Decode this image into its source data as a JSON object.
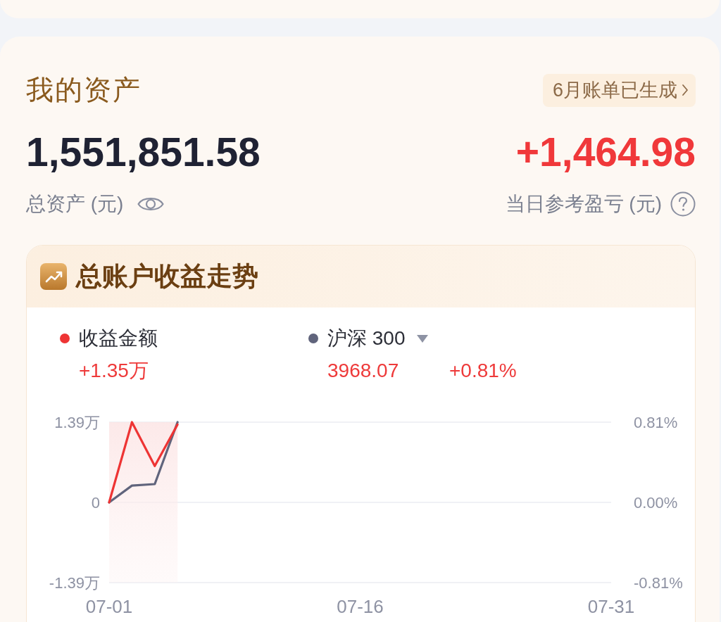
{
  "assets": {
    "title": "我的资产",
    "bill_notice": "6月账单已生成",
    "total": "1,551,851.58",
    "total_label": "总资产 (元)",
    "daily_pnl": "+1,464.98",
    "daily_pnl_label": "当日参考盈亏 (元)"
  },
  "trend": {
    "title": "总账户收益走势",
    "legend": [
      {
        "readings": [
          "+1.35万"
        ],
        "dropdown": false
      },
      {
        "readings": [
          "3968.07",
          "+0.81%"
        ],
        "dropdown": true
      }
    ],
    "chart_data": {
      "type": "line",
      "categories": [
        "07-01",
        null,
        null,
        null,
        null,
        null,
        null,
        null,
        null,
        null,
        null,
        "07-16",
        null,
        null,
        null,
        null,
        null,
        null,
        null,
        null,
        null,
        null,
        "07-31"
      ],
      "ylim": [
        -1.39,
        1.39
      ],
      "yticks": [
        {
          "value": 1.39,
          "label": "1.39万"
        },
        {
          "value": 0,
          "label": "0"
        },
        {
          "value": -1.39,
          "label": "-1.39万"
        }
      ],
      "y2lim": [
        -0.81,
        0.81
      ],
      "y2ticks": [
        {
          "value": 0.81,
          "label": "0.81%"
        },
        {
          "value": 0,
          "label": "0.00%"
        },
        {
          "value": -0.81,
          "label": "-0.81%"
        }
      ],
      "series": [
        {
          "name": "收益金额",
          "color": "#ee3434",
          "values": [
            0,
            1.39,
            0.63,
            1.35,
            null,
            null,
            null,
            null,
            null,
            null,
            null,
            null,
            null,
            null,
            null,
            null,
            null,
            null,
            null,
            null,
            null,
            null,
            null
          ]
        },
        {
          "name": "沪深 300",
          "color": "#60647c",
          "axis": "y2",
          "values": [
            0,
            0.17,
            0.185,
            0.81,
            null,
            null,
            null,
            null,
            null,
            null,
            null,
            null,
            null,
            null,
            null,
            null,
            null,
            null,
            null,
            null,
            null,
            null,
            null
          ]
        }
      ]
    }
  }
}
